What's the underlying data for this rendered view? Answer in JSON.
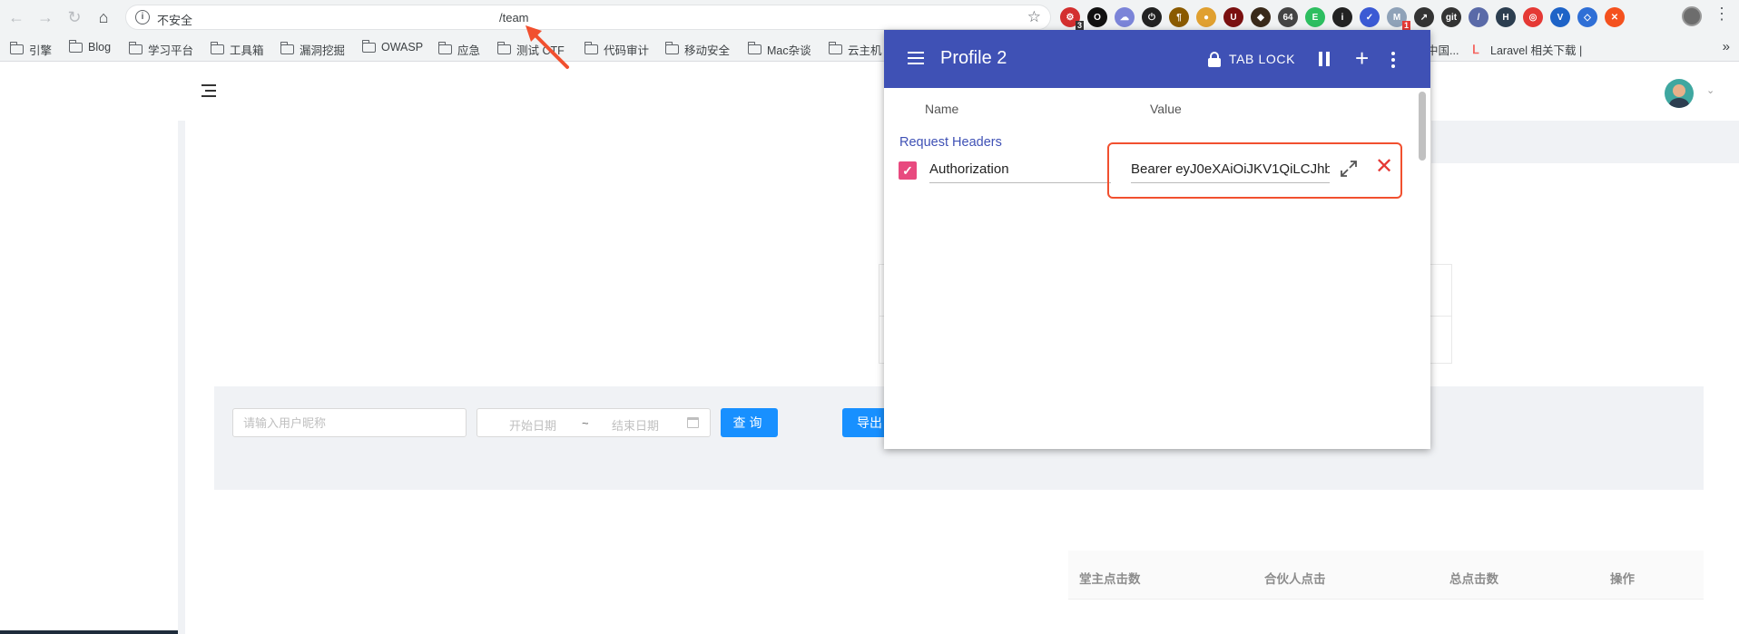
{
  "browser": {
    "security_label": "不安全",
    "url_tail": "/team",
    "extension_badges": {
      "first": "3",
      "active": "1"
    },
    "extensions": [
      {
        "name": "trace-icon",
        "color": "#d32f2f",
        "glyph": "⚙"
      },
      {
        "name": "black-circle-icon",
        "color": "#111111",
        "glyph": "O"
      },
      {
        "name": "cloud-icon",
        "color": "#7b84d8",
        "glyph": "☁"
      },
      {
        "name": "power-icon",
        "color": "#222222",
        "glyph": "⏻"
      },
      {
        "name": "paragraph-icon",
        "color": "#8a5a00",
        "glyph": "¶"
      },
      {
        "name": "cookie-icon",
        "color": "#e0a030",
        "glyph": "●"
      },
      {
        "name": "ublock-icon",
        "color": "#7a1010",
        "glyph": "U"
      },
      {
        "name": "dark-shield-icon",
        "color": "#3a2a1a",
        "glyph": "◆"
      },
      {
        "name": "base64-icon",
        "color": "#444444",
        "glyph": "64"
      },
      {
        "name": "evernote-icon",
        "color": "#2dbe60",
        "glyph": "E"
      },
      {
        "name": "info-icon",
        "color": "#222222",
        "glyph": "i"
      },
      {
        "name": "check-circle-icon",
        "color": "#3b5ad4",
        "glyph": "✓"
      },
      {
        "name": "modheader-icon",
        "color": "#8fa2b8",
        "glyph": "M"
      },
      {
        "name": "chart-icon",
        "color": "#333333",
        "glyph": "↗"
      },
      {
        "name": "gitzip-icon",
        "color": "#333333",
        "glyph": "git"
      },
      {
        "name": "wappalyzer-icon",
        "color": "#5a6aa8",
        "glyph": "/"
      },
      {
        "name": "hackbar-icon",
        "color": "#2c3e50",
        "glyph": "H"
      },
      {
        "name": "target-icon",
        "color": "#e53935",
        "glyph": "◎"
      },
      {
        "name": "vue-icon",
        "color": "#1e63c7",
        "glyph": "V"
      },
      {
        "name": "diamond-icon",
        "color": "#2f6fd6",
        "glyph": "◇"
      },
      {
        "name": "tool-icon",
        "color": "#f4511e",
        "glyph": "✕"
      }
    ]
  },
  "bookmarks": [
    {
      "label": "引擎"
    },
    {
      "label": "Blog"
    },
    {
      "label": "学习平台"
    },
    {
      "label": "工具箱"
    },
    {
      "label": "漏洞挖掘"
    },
    {
      "label": "OWASP"
    },
    {
      "label": "应急"
    },
    {
      "label": "测试 CTF"
    },
    {
      "label": "代码审计"
    },
    {
      "label": "移动安全"
    },
    {
      "label": "Mac杂谈"
    },
    {
      "label": "云主机"
    },
    {
      "label": "中国..."
    },
    {
      "label": "Laravel 相关下载 |"
    }
  ],
  "filter": {
    "user_placeholder": "请输入用户昵称",
    "start_date": "开始日期",
    "range_separator": "~",
    "end_date": "结束日期",
    "query_label": "查询",
    "export_label": "导出"
  },
  "table": {
    "columns": [
      "堂主点击数",
      "合伙人点击",
      "总点击数",
      "操作"
    ]
  },
  "popup": {
    "title": "Profile 2",
    "tab_lock": "TAB LOCK",
    "col_name": "Name",
    "col_value": "Value",
    "section": "Request Headers",
    "header_name": "Authorization",
    "header_value": "Bearer eyJ0eXAiOiJKV1QiLCJhb",
    "colors": {
      "primary": "#3f51b5",
      "checkbox": "#e84a7f",
      "remove": "#e53935",
      "highlight": "#f1502f"
    }
  }
}
